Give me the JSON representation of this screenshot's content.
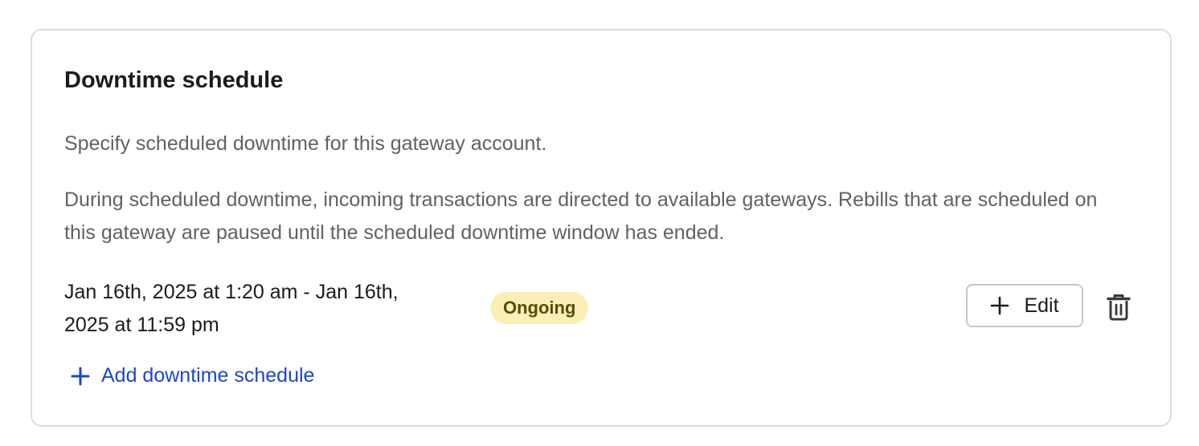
{
  "card": {
    "title": "Downtime schedule",
    "description_1": "Specify scheduled downtime for this gateway account.",
    "description_2": "During scheduled downtime, incoming transactions are directed to available gateways. Rebills that are scheduled on this gateway are paused until the scheduled downtime window has ended."
  },
  "schedules": [
    {
      "range_line_1": "Jan 16th, 2025 at 1:20 am - Jan 16th,",
      "range_line_2": "2025 at 11:59 pm",
      "status": "Ongoing",
      "edit_label": "Edit",
      "edit_icon": "plus-icon",
      "delete_icon": "trash-icon"
    }
  ],
  "add_link": {
    "label": "Add downtime schedule",
    "icon": "plus-icon"
  },
  "colors": {
    "link": "#1d47c7",
    "badge_bg": "#fbefb8",
    "badge_text": "#5c4a06",
    "border": "#dcdcde",
    "muted_text": "#616166"
  }
}
